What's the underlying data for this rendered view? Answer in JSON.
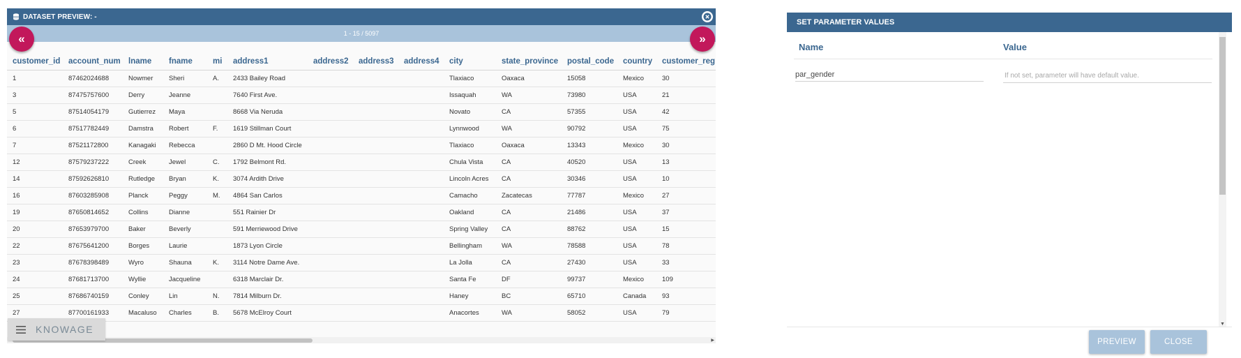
{
  "preview": {
    "title": "DATASET PREVIEW: -",
    "pager_text": "1 - 15 / 5097",
    "prev_label": "«",
    "next_label": "»",
    "brand": "KNOWAGE",
    "columns": [
      "customer_id",
      "account_num",
      "lname",
      "fname",
      "mi",
      "address1",
      "address2",
      "address3",
      "address4",
      "city",
      "state_province",
      "postal_code",
      "country",
      "customer_reg"
    ],
    "rows": [
      [
        "1",
        "87462024688",
        "Nowmer",
        "Sheri",
        "A.",
        "2433 Bailey Road",
        "",
        "",
        "",
        "Tlaxiaco",
        "Oaxaca",
        "15058",
        "Mexico",
        "30"
      ],
      [
        "3",
        "87475757600",
        "Derry",
        "Jeanne",
        "",
        "7640 First Ave.",
        "",
        "",
        "",
        "Issaquah",
        "WA",
        "73980",
        "USA",
        "21"
      ],
      [
        "5",
        "87514054179",
        "Gutierrez",
        "Maya",
        "",
        "8668 Via Neruda",
        "",
        "",
        "",
        "Novato",
        "CA",
        "57355",
        "USA",
        "42"
      ],
      [
        "6",
        "87517782449",
        "Damstra",
        "Robert",
        "F.",
        "1619 Stillman Court",
        "",
        "",
        "",
        "Lynnwood",
        "WA",
        "90792",
        "USA",
        "75"
      ],
      [
        "7",
        "87521172800",
        "Kanagaki",
        "Rebecca",
        "",
        "2860 D Mt. Hood Circle",
        "",
        "",
        "",
        "Tlaxiaco",
        "Oaxaca",
        "13343",
        "Mexico",
        "30"
      ],
      [
        "12",
        "87579237222",
        "Creek",
        "Jewel",
        "C.",
        "1792 Belmont Rd.",
        "",
        "",
        "",
        "Chula Vista",
        "CA",
        "40520",
        "USA",
        "13"
      ],
      [
        "14",
        "87592626810",
        "Rutledge",
        "Bryan",
        "K.",
        "3074 Ardith Drive",
        "",
        "",
        "",
        "Lincoln Acres",
        "CA",
        "30346",
        "USA",
        "10"
      ],
      [
        "16",
        "87603285908",
        "Planck",
        "Peggy",
        "M.",
        "4864 San Carlos",
        "",
        "",
        "",
        "Camacho",
        "Zacatecas",
        "77787",
        "Mexico",
        "27"
      ],
      [
        "19",
        "87650814652",
        "Collins",
        "Dianne",
        "",
        "551 Rainier Dr",
        "",
        "",
        "",
        "Oakland",
        "CA",
        "21486",
        "USA",
        "37"
      ],
      [
        "20",
        "87653979700",
        "Baker",
        "Beverly",
        "",
        "591 Merriewood Drive",
        "",
        "",
        "",
        "Spring Valley",
        "CA",
        "88762",
        "USA",
        "15"
      ],
      [
        "22",
        "87675641200",
        "Borges",
        "Laurie",
        "",
        "1873 Lyon Circle",
        "",
        "",
        "",
        "Bellingham",
        "WA",
        "78588",
        "USA",
        "78"
      ],
      [
        "23",
        "87678398489",
        "Wyro",
        "Shauna",
        "K.",
        "3114 Notre Dame Ave.",
        "",
        "",
        "",
        "La Jolla",
        "CA",
        "27430",
        "USA",
        "33"
      ],
      [
        "24",
        "87681713700",
        "Wyllie",
        "Jacqueline",
        "",
        "6318 Marclair Dr.",
        "",
        "",
        "",
        "Santa Fe",
        "DF",
        "99737",
        "Mexico",
        "109"
      ],
      [
        "25",
        "87686740159",
        "Conley",
        "Lin",
        "N.",
        "7814 Milburn Dr.",
        "",
        "",
        "",
        "Haney",
        "BC",
        "65710",
        "Canada",
        "93"
      ],
      [
        "27",
        "87700161933",
        "Macaluso",
        "Charles",
        "B.",
        "5678 McElroy Court",
        "",
        "",
        "",
        "Anacortes",
        "WA",
        "58052",
        "USA",
        "79"
      ]
    ]
  },
  "params": {
    "title": "SET PARAMETER VALUES",
    "name_header": "Name",
    "value_header": "Value",
    "param_name": "par_gender",
    "value_placeholder": "If not set, parameter will have default value.",
    "preview_label": "PREVIEW",
    "close_label": "CLOSE"
  },
  "colors": {
    "header_blue": "#3b6790",
    "pager_blue": "#a9c3db",
    "accent_pink": "#c2185b"
  }
}
